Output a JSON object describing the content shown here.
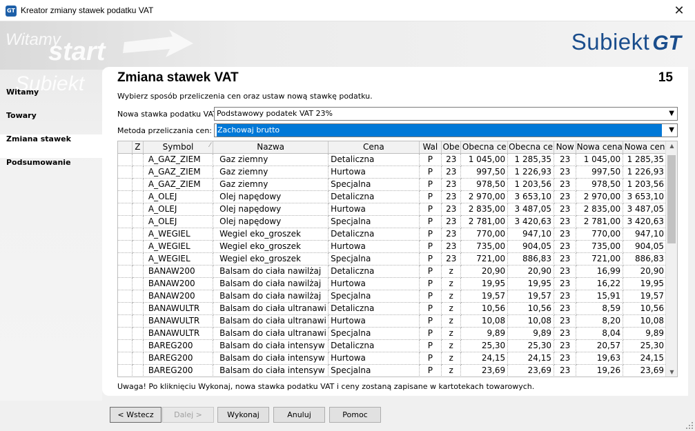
{
  "window": {
    "app_icon_text": "GT",
    "title": "Kreator zmiany stawek podatku VAT",
    "close_glyph": "✕"
  },
  "branding": {
    "logo_word": "Subiekt",
    "logo_mark": "GT",
    "banner_watermark_1": "Witamy",
    "banner_watermark_2": "start",
    "sidebar_watermark": "Subiekt"
  },
  "sidebar": {
    "items": [
      {
        "label": "Witamy",
        "active": false
      },
      {
        "label": "Towary",
        "active": false
      },
      {
        "label": "Zmiana stawek",
        "active": true
      },
      {
        "label": "Podsumowanie",
        "active": false
      }
    ]
  },
  "page": {
    "title": "Zmiana stawek VAT",
    "step_number": "15",
    "instruction": "Wybierz sposób przeliczenia cen oraz ustaw nową stawkę podatku."
  },
  "form": {
    "vat_label": "Nowa stawka podatku VAT:",
    "vat_value": "Podstawowy podatek VAT 23%",
    "method_label": "Metoda przeliczania cen:",
    "method_value": "Zachowaj brutto"
  },
  "table": {
    "columns": [
      "",
      "Z",
      "Symbol",
      "Nazwa",
      "Cena",
      "Wal",
      "Obe",
      "Obecna ce",
      "Obecna ce",
      "Now",
      "Nowa cena",
      "Nowa cen"
    ],
    "rows": [
      [
        "",
        "",
        "A_GAZ_ZIEM",
        "Gaz ziemny",
        "Detaliczna",
        "P",
        "23",
        "1 045,00",
        "1 285,35",
        "23",
        "1 045,00",
        "1 285,35"
      ],
      [
        "",
        "",
        "A_GAZ_ZIEM",
        "Gaz ziemny",
        "Hurtowa",
        "P",
        "23",
        "997,50",
        "1 226,93",
        "23",
        "997,50",
        "1 226,93"
      ],
      [
        "",
        "",
        "A_GAZ_ZIEM",
        "Gaz ziemny",
        "Specjalna",
        "P",
        "23",
        "978,50",
        "1 203,56",
        "23",
        "978,50",
        "1 203,56"
      ],
      [
        "",
        "",
        "A_OLEJ",
        "Olej napędowy",
        "Detaliczna",
        "P",
        "23",
        "2 970,00",
        "3 653,10",
        "23",
        "2 970,00",
        "3 653,10"
      ],
      [
        "",
        "",
        "A_OLEJ",
        "Olej napędowy",
        "Hurtowa",
        "P",
        "23",
        "2 835,00",
        "3 487,05",
        "23",
        "2 835,00",
        "3 487,05"
      ],
      [
        "",
        "",
        "A_OLEJ",
        "Olej napędowy",
        "Specjalna",
        "P",
        "23",
        "2 781,00",
        "3 420,63",
        "23",
        "2 781,00",
        "3 420,63"
      ],
      [
        "",
        "",
        "A_WEGIEL",
        "Wegiel eko_groszek",
        "Detaliczna",
        "P",
        "23",
        "770,00",
        "947,10",
        "23",
        "770,00",
        "947,10"
      ],
      [
        "",
        "",
        "A_WEGIEL",
        "Wegiel eko_groszek",
        "Hurtowa",
        "P",
        "23",
        "735,00",
        "904,05",
        "23",
        "735,00",
        "904,05"
      ],
      [
        "",
        "",
        "A_WEGIEL",
        "Wegiel eko_groszek",
        "Specjalna",
        "P",
        "23",
        "721,00",
        "886,83",
        "23",
        "721,00",
        "886,83"
      ],
      [
        "",
        "",
        "BANAW200",
        "Balsam do ciała nawilżaj",
        "Detaliczna",
        "P",
        "z",
        "20,90",
        "20,90",
        "23",
        "16,99",
        "20,90"
      ],
      [
        "",
        "",
        "BANAW200",
        "Balsam do ciała nawilżaj",
        "Hurtowa",
        "P",
        "z",
        "19,95",
        "19,95",
        "23",
        "16,22",
        "19,95"
      ],
      [
        "",
        "",
        "BANAW200",
        "Balsam do ciała nawilżaj",
        "Specjalna",
        "P",
        "z",
        "19,57",
        "19,57",
        "23",
        "15,91",
        "19,57"
      ],
      [
        "",
        "",
        "BANAWULTR",
        "Balsam do ciała ultranawi",
        "Detaliczna",
        "P",
        "z",
        "10,56",
        "10,56",
        "23",
        "8,59",
        "10,56"
      ],
      [
        "",
        "",
        "BANAWULTR",
        "Balsam do ciała ultranawi",
        "Hurtowa",
        "P",
        "z",
        "10,08",
        "10,08",
        "23",
        "8,20",
        "10,08"
      ],
      [
        "",
        "",
        "BANAWULTR",
        "Balsam do ciała ultranawi",
        "Specjalna",
        "P",
        "z",
        "9,89",
        "9,89",
        "23",
        "8,04",
        "9,89"
      ],
      [
        "",
        "",
        "BAREG200",
        "Balsam do ciała intensyw",
        "Detaliczna",
        "P",
        "z",
        "25,30",
        "25,30",
        "23",
        "20,57",
        "25,30"
      ],
      [
        "",
        "",
        "BAREG200",
        "Balsam do ciała intensyw",
        "Hurtowa",
        "P",
        "z",
        "24,15",
        "24,15",
        "23",
        "19,63",
        "24,15"
      ],
      [
        "",
        "",
        "BAREG200",
        "Balsam do ciała intensyw",
        "Specjalna",
        "P",
        "z",
        "23,69",
        "23,69",
        "23",
        "19,26",
        "23,69"
      ]
    ]
  },
  "warning": "Uwaga! Po kliknięciu Wykonaj, nowa stawka podatku VAT i ceny zostaną zapisane w kartotekach towarowych.",
  "buttons": {
    "back": "< Wstecz",
    "next": "Dalej >",
    "execute": "Wykonaj",
    "cancel": "Anuluj",
    "help": "Pomoc"
  },
  "colors": {
    "selection": "#0078d7",
    "logo": "#1a4d8c"
  }
}
